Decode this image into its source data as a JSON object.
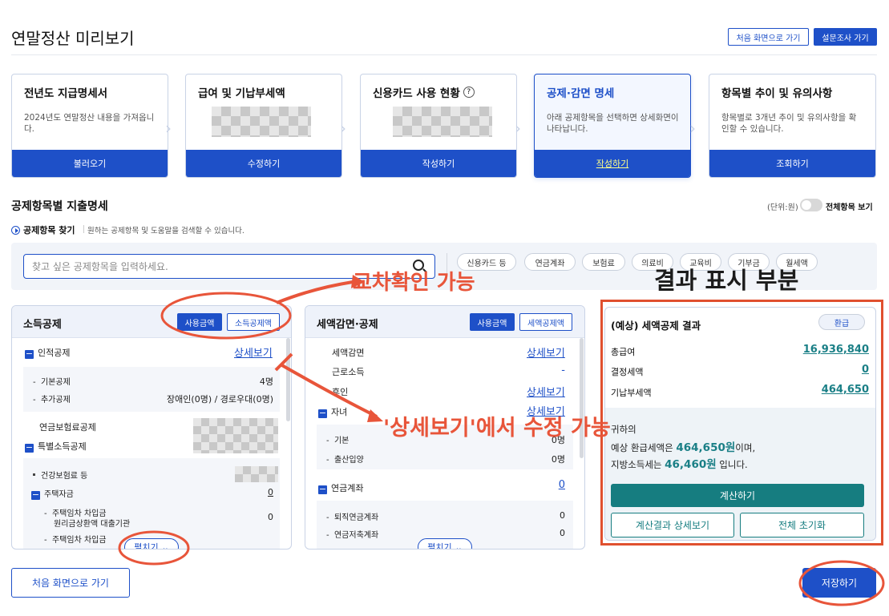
{
  "header": {
    "title": "연말정산 미리보기",
    "btn_home": "처음 화면으로 가기",
    "btn_survey": "설문조사 가기"
  },
  "steps": [
    {
      "title": "전년도 지급명세서",
      "desc": "2024년도 연말정산 내용을 가져옵니다.",
      "button": "불러오기"
    },
    {
      "title": "급여 및 기납부세액",
      "desc": "",
      "button": "수정하기"
    },
    {
      "title": "신용카드 사용 현황",
      "help": "?",
      "desc": "",
      "button": "작성하기"
    },
    {
      "title": "공제·감면 명세",
      "desc": "아래 공제항목을 선택하면 상세화면이 나타납니다.",
      "button": "작성하기"
    },
    {
      "title": "항목별 추이 및 유의사항",
      "desc": "항목별로 3개년 추이 및 유의사항을 확인할 수 있습니다.",
      "button": "조회하기"
    }
  ],
  "section": {
    "title": "공제항목별 지출명세",
    "unit": "(단위:원)",
    "toggle_label": "전체항목 보기"
  },
  "finder": {
    "title": "공제항목 찾기",
    "desc": "원하는 공제항목 및 도움말을 검색할 수 있습니다.",
    "placeholder": "찾고 싶은 공제항목을 입력하세요.",
    "chips": [
      "신용카드 등",
      "연금계좌",
      "보험료",
      "의료비",
      "교육비",
      "기부금",
      "월세액"
    ]
  },
  "income_panel": {
    "title": "소득공제",
    "seg_on": "사용금액",
    "seg_off": "소득공제액",
    "personal": "인적공제",
    "detail_link": "상세보기",
    "basic": "기본공제",
    "basic_val": "4명",
    "extra": "추가공제",
    "extra_val": "장애인(0명) / 경로우대(0명)",
    "pension": "연금보험료공제",
    "special": "특별소득공제",
    "health": "건강보험료 등",
    "housing": "주택자금",
    "housing_val": "0",
    "loan1": "주택임차 차입금",
    "loan1b": "원리금상환액 대출기관",
    "loan1_val": "0",
    "loan2": "주택임차 차입금",
    "expand": "펼치기"
  },
  "tax_panel": {
    "title": "세액감면·공제",
    "seg_on": "사용금액",
    "seg_off": "세액공제액",
    "reduction": "세액감면",
    "reduction_link": "상세보기",
    "earned": "근로소득",
    "earned_val": "-",
    "dependents": "후인",
    "dependents_link": "상세보기",
    "children": "자녀",
    "children_link": "상세보기",
    "child_basic": "기본",
    "child_basic_val": "0명",
    "child_birth": "출산입양",
    "child_birth_val": "0명",
    "pension_acct": "연금계좌",
    "pension_acct_val": "0",
    "retire": "퇴직연금계좌",
    "retire_val": "0",
    "savings": "연금저축계좌",
    "savings_val": "0",
    "expand": "펼치기"
  },
  "result_panel": {
    "title": "(예상) 세액공제 결과",
    "badge": "환급",
    "rows": [
      {
        "label": "총급여",
        "value": "16,936,840"
      },
      {
        "label": "결정세액",
        "value": "0"
      },
      {
        "label": "기납부세액",
        "value": "464,650"
      }
    ],
    "line1": "귀하의",
    "line2_prefix": "예상 환급세액은 ",
    "line2_amount": "464,650원",
    "line2_suffix": "이며,",
    "line3_prefix": "지방소득세는 ",
    "line3_amount": "46,460원",
    "line3_suffix": " 입니다.",
    "calc_button": "계산하기",
    "detail_button": "계산결과 상세보기",
    "reset_button": "전체 초기화"
  },
  "footer": {
    "back": "처음 화면으로 가기",
    "save": "저장하기"
  },
  "annotations": {
    "cross_check": "교차확인 가능",
    "result_area": "결과 표시 부분",
    "editable": "'상세보기'에서 수정 가능",
    "color": "#e8553a"
  }
}
